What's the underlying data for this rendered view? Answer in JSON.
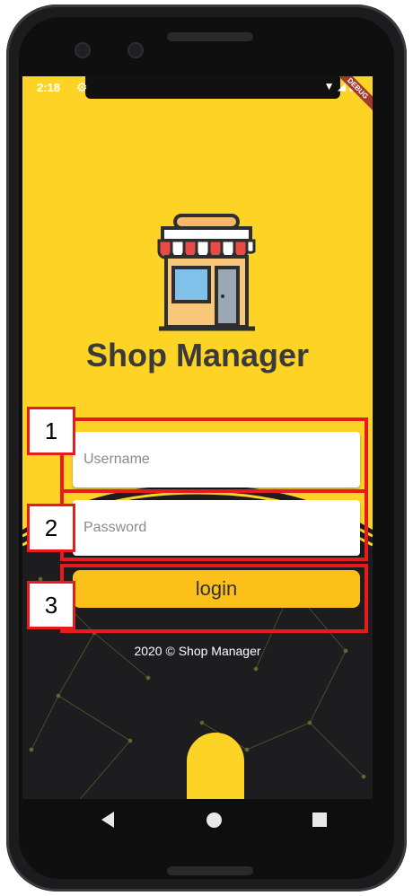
{
  "status_bar": {
    "time": "2:18",
    "debug_banner": "DEBUG"
  },
  "app": {
    "title": "Shop Manager"
  },
  "form": {
    "username_placeholder": "Username",
    "password_placeholder": "Password",
    "login_label": "login"
  },
  "footer": {
    "text": "2020 © Shop Manager"
  },
  "annotations": {
    "labels": [
      "1",
      "2",
      "3"
    ]
  },
  "colors": {
    "brand_yellow": "#fdd426",
    "button_yellow": "#fdc01b",
    "annotation_red": "#e71b1b",
    "dark_bg": "#1d1d1f"
  },
  "icons": [
    "settings-gear-icon",
    "wifi-icon",
    "signal-icon",
    "battery-icon",
    "shop-logo-icon",
    "nav-back-icon",
    "nav-home-icon",
    "nav-recent-icon"
  ]
}
